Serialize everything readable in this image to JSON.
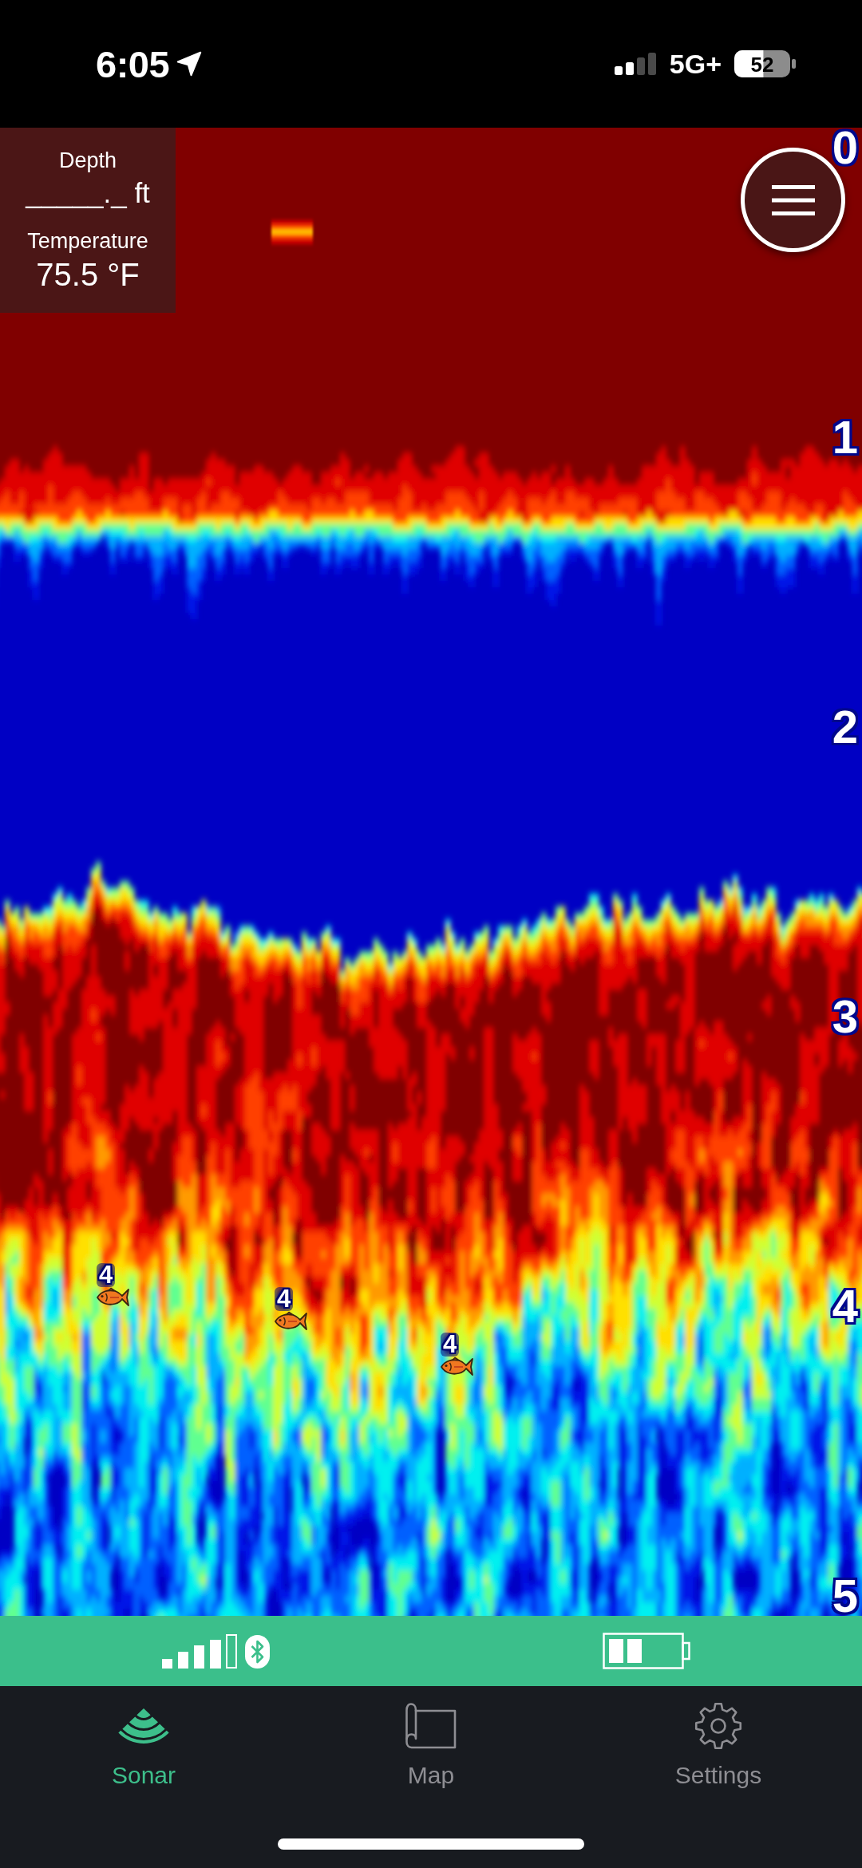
{
  "status_bar": {
    "time": "6:05",
    "network": "5G+",
    "battery": "52"
  },
  "readout": {
    "depth_label": "Depth",
    "depth_value": "_____._ ft",
    "temperature_label": "Temperature",
    "temperature_value": "75.5 °F"
  },
  "depth_scale": [
    "0",
    "1",
    "2",
    "3",
    "4",
    "5"
  ],
  "fish_marks": [
    {
      "label": "4"
    },
    {
      "label": "4"
    },
    {
      "label": "4"
    }
  ],
  "tabs": [
    {
      "label": "Sonar",
      "selected": true
    },
    {
      "label": "Map",
      "selected": false
    },
    {
      "label": "Settings",
      "selected": false
    }
  ]
}
